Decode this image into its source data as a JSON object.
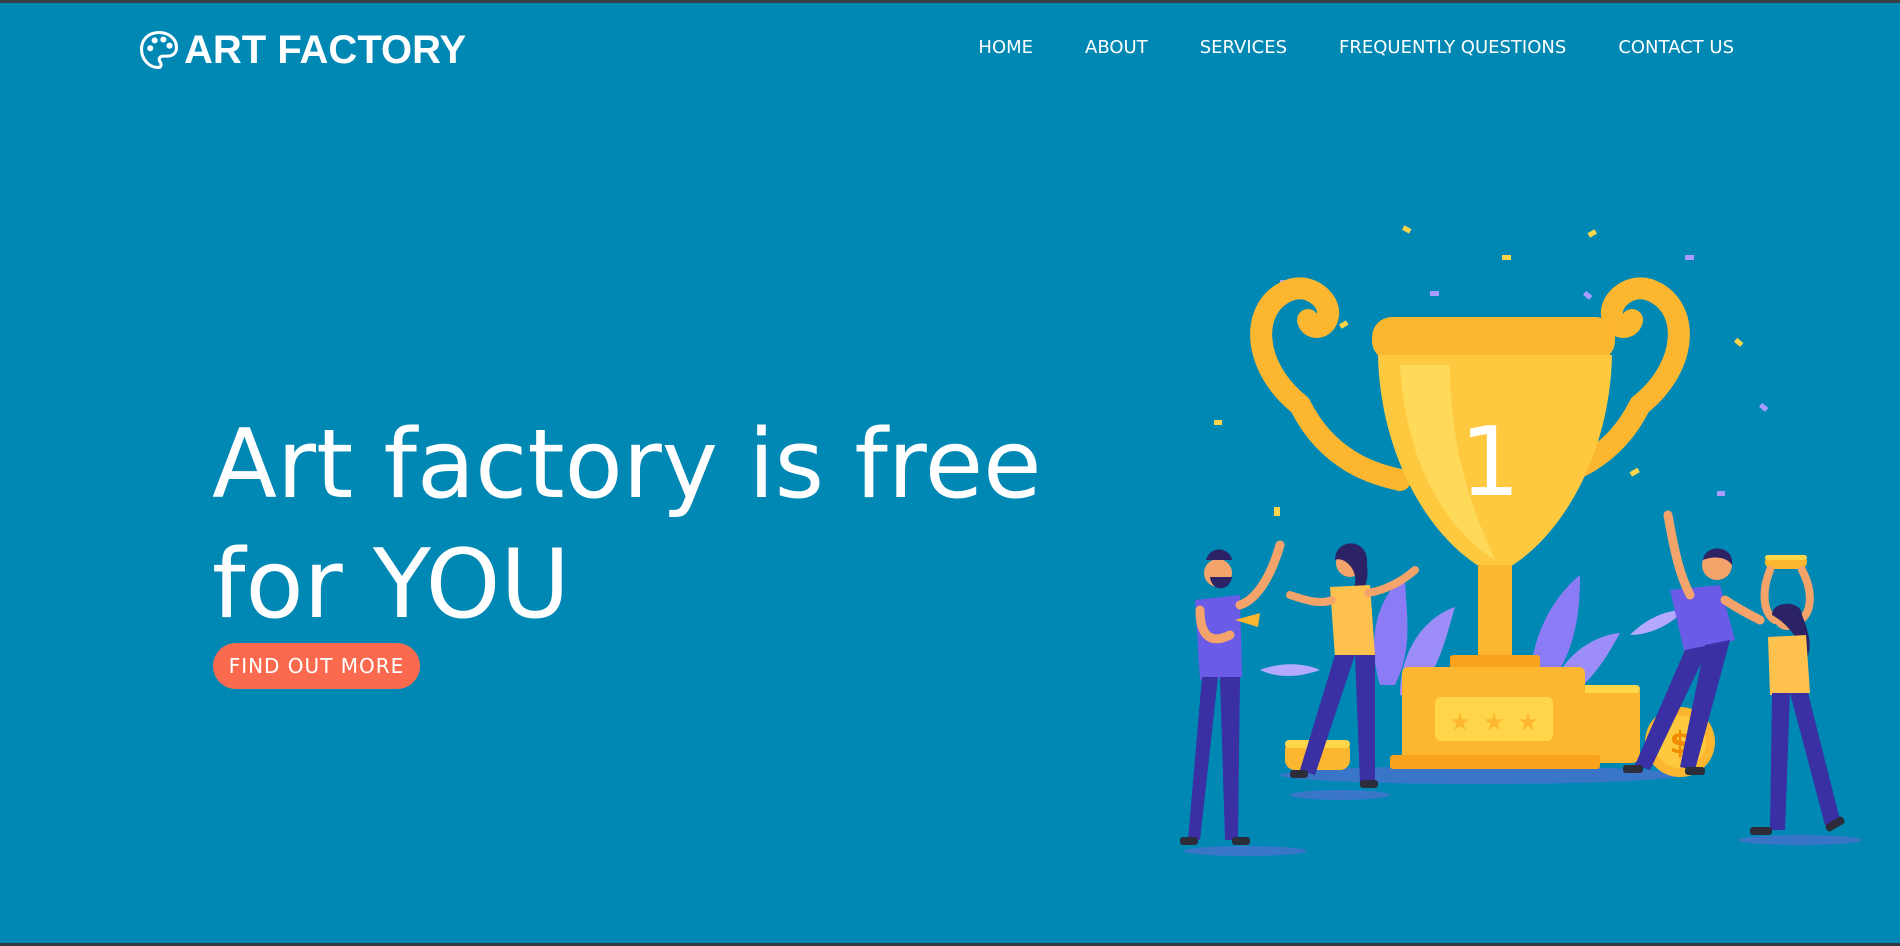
{
  "brand": {
    "name": "ART FACTORY",
    "logo": "palette-icon"
  },
  "nav": {
    "items": [
      {
        "label": "HOME"
      },
      {
        "label": "ABOUT"
      },
      {
        "label": "SERVICES"
      },
      {
        "label": "FREQUENTLY QUESTIONS"
      },
      {
        "label": "CONTACT US"
      }
    ]
  },
  "hero": {
    "title_line1": "Art factory is free",
    "title_line2": "for YOU",
    "cta_label": "FIND OUT MORE",
    "trophy_number": "1"
  },
  "colors": {
    "background": "#0088b5",
    "cta": "#fb6a4f",
    "trophy": "#fdb62f",
    "people": "#6b5ce7",
    "pants": "#3a2fa3"
  }
}
